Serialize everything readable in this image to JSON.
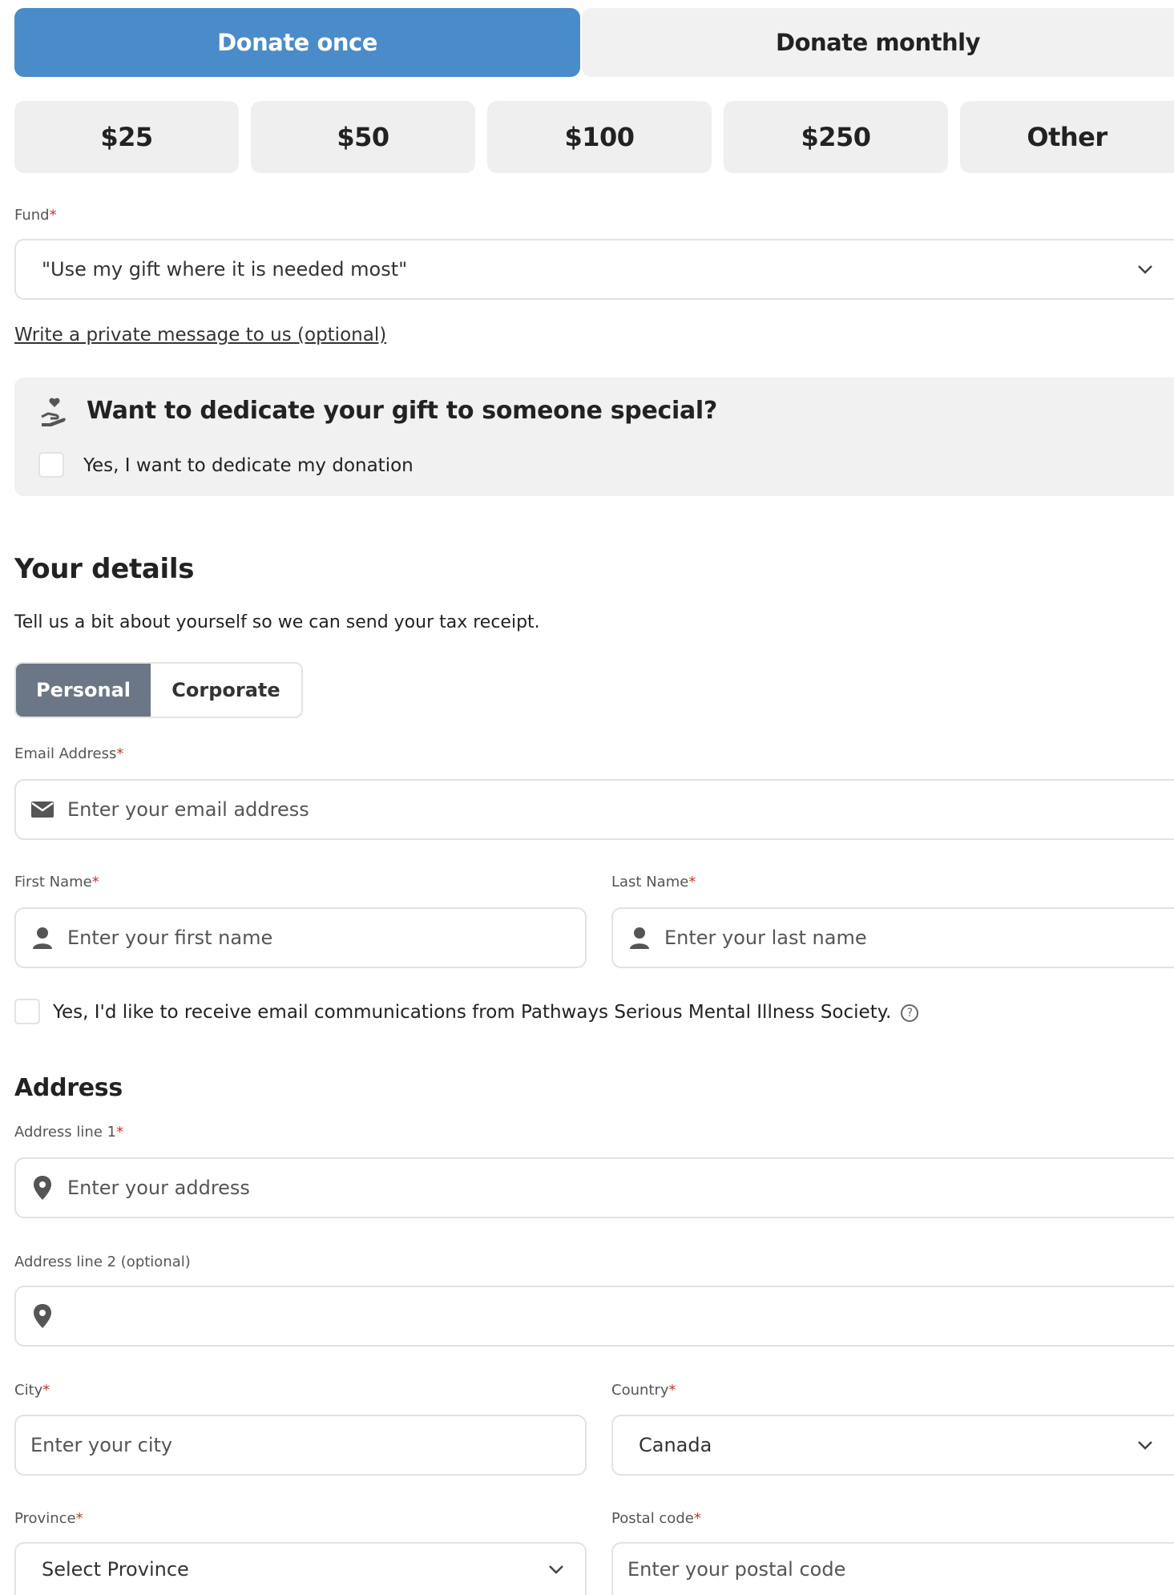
{
  "frequency": {
    "once_label": "Donate once",
    "monthly_label": "Donate monthly",
    "selected": "once"
  },
  "amounts": [
    "$25",
    "$50",
    "$100",
    "$250",
    "Other"
  ],
  "fund": {
    "label": "Fund",
    "required_mark": "*",
    "value": "\"Use my gift where it is needed most\""
  },
  "private_message_link": "Write a private message to us (optional)",
  "dedicate": {
    "title": "Want to dedicate your gift to someone special?",
    "checkbox_label": "Yes, I want to dedicate my donation",
    "icon": "hand-heart-icon"
  },
  "details": {
    "heading": "Your details",
    "subtext": "Tell us a bit about yourself so we can send your tax receipt.",
    "type_personal": "Personal",
    "type_corporate": "Corporate",
    "selected_type": "Personal"
  },
  "email": {
    "label": "Email Address",
    "required_mark": "*",
    "placeholder": "Enter your email address",
    "icon": "envelope-icon"
  },
  "first_name": {
    "label": "First Name",
    "required_mark": "*",
    "placeholder": "Enter your first name",
    "icon": "person-icon"
  },
  "last_name": {
    "label": "Last Name",
    "required_mark": "*",
    "placeholder": "Enter your last name",
    "icon": "person-icon"
  },
  "comms_checkbox_label": "Yes, I'd like to receive email communications from Pathways Serious Mental Illness Society.",
  "address": {
    "heading": "Address",
    "line1_label": "Address line 1",
    "line1_required_mark": "*",
    "line1_placeholder": "Enter your address",
    "line2_label": "Address line 2 (optional)",
    "line2_placeholder": "",
    "city_label": "City",
    "city_required_mark": "*",
    "city_placeholder": "Enter your city",
    "country_label": "Country",
    "country_required_mark": "*",
    "country_value": "Canada",
    "province_label": "Province",
    "province_required_mark": "*",
    "province_value": "Select Province",
    "postal_label": "Postal code",
    "postal_required_mark": "*",
    "postal_placeholder": "Enter your postal code"
  },
  "colors": {
    "primary": "#4a8bc9",
    "toggle_selected": "#6b7686",
    "required": "#c0392b",
    "panel_bg": "#f1f1f2"
  }
}
